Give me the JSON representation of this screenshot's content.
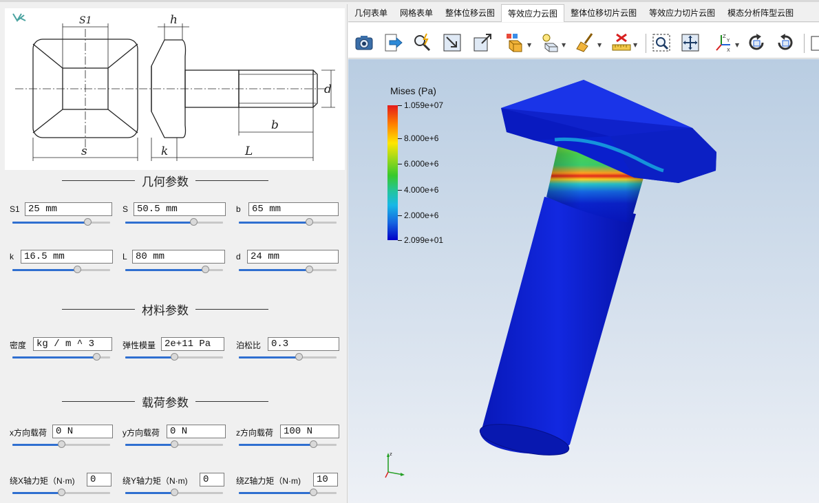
{
  "drawing": {
    "dims": {
      "s1": "S1",
      "h": "h",
      "d": "d",
      "b": "b",
      "s": "s",
      "k": "k",
      "L": "L"
    }
  },
  "sections": {
    "geometry": "几何参数",
    "material": "材料参数",
    "load": "载荷参数"
  },
  "geometry_params": [
    {
      "label": "S1",
      "value": "25 mm",
      "slider": 0.77
    },
    {
      "label": "S",
      "value": "50.5 mm",
      "slider": 0.7
    },
    {
      "label": "b",
      "value": "65 mm",
      "slider": 0.72
    },
    {
      "label": "k",
      "value": "16.5 mm",
      "slider": 0.66
    },
    {
      "label": "L",
      "value": "80 mm",
      "slider": 0.82
    },
    {
      "label": "d",
      "value": "24 mm",
      "slider": 0.72
    }
  ],
  "material_params": [
    {
      "label": "密度",
      "value": "kg / m ^ 3",
      "slider": 0.86
    },
    {
      "label": "弹性模量",
      "value": "2e+11 Pa",
      "slider": 0.5
    },
    {
      "label": "泊松比",
      "value": "0.3",
      "slider": 0.61
    }
  ],
  "load_params": [
    {
      "label": "x方向载荷",
      "value": "0 N",
      "slider": 0.5
    },
    {
      "label": "y方向载荷",
      "value": "0 N",
      "slider": 0.5
    },
    {
      "label": "z方向载荷",
      "value": "100 N",
      "slider": 0.76
    },
    {
      "label": "绕X轴力矩（N·m)",
      "value": "0",
      "slider": 0.5
    },
    {
      "label": "绕Y轴力矩（N·m)",
      "value": "0",
      "slider": 0.5
    },
    {
      "label": "绕Z轴力矩（N·m)",
      "value": "10",
      "slider": 0.76
    }
  ],
  "tabs": [
    "几何表单",
    "网格表单",
    "整体位移云图",
    "等效应力云图",
    "整体位移切片云图",
    "等效应力切片云图",
    "模态分析阵型云图"
  ],
  "active_tab": 3,
  "toolbar_icons": [
    "camera-icon",
    "export-icon",
    "probe-icon",
    "fit-view-icon",
    "reset-view-icon",
    "display-mode-icon",
    "render-mode-icon",
    "clear-icon",
    "ruler-icon",
    "zoom-box-icon",
    "pan-icon",
    "axes-orient-icon",
    "rotate-cw-icon",
    "rotate-ccw-icon"
  ],
  "legend": {
    "title": "Mises (Pa)",
    "ticks": [
      "1.059e+07",
      "8.000e+6",
      "6.000e+6",
      "4.000e+6",
      "2.000e+6",
      "2.099e+01"
    ]
  },
  "colors": {
    "accent": "#2f6fd0",
    "stress_low": "#0000c8",
    "stress_high": "#e31a1a"
  }
}
